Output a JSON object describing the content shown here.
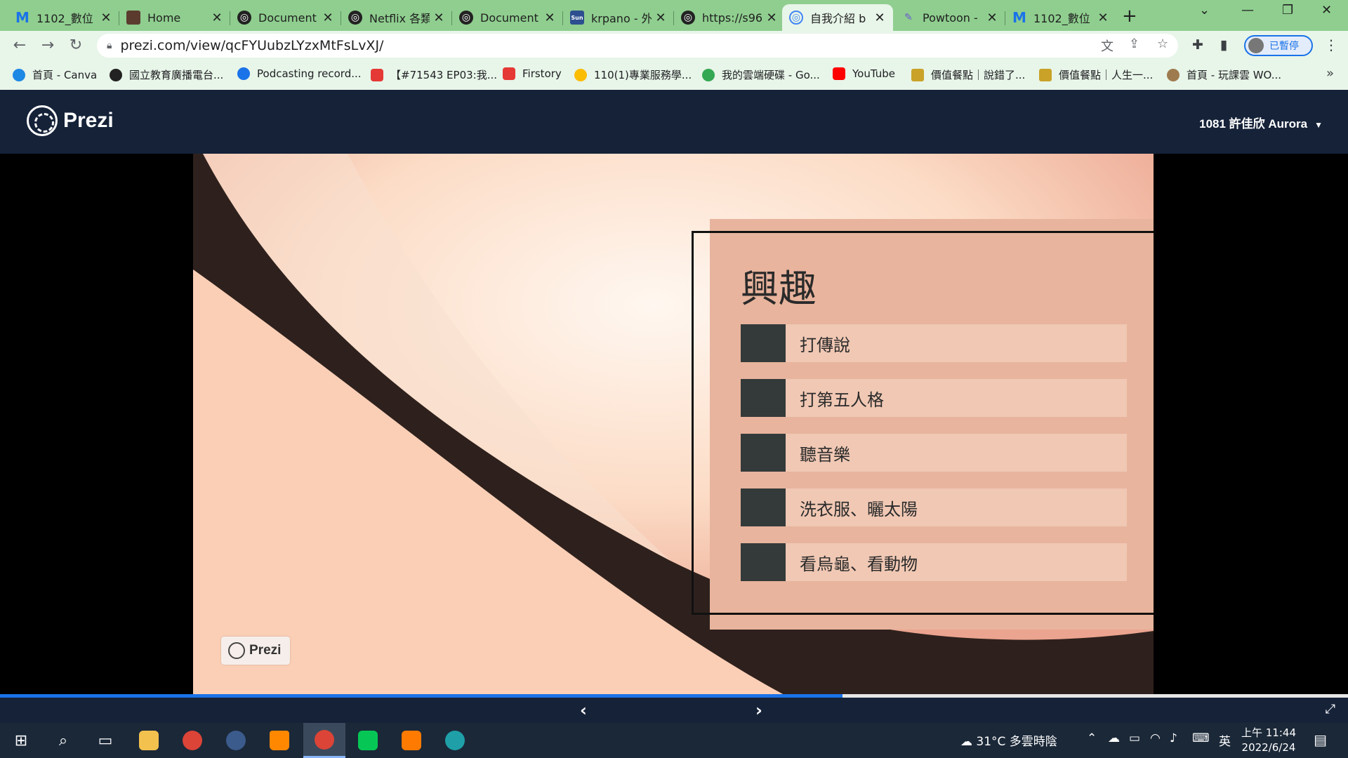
{
  "browser": {
    "tabs": [
      {
        "title": "1102_數位",
        "icon": "m-logo-icon"
      },
      {
        "title": "Home",
        "icon": "home-favicon-icon"
      },
      {
        "title": "Document",
        "icon": "globe-icon"
      },
      {
        "title": "Netflix 各類",
        "icon": "globe-icon"
      },
      {
        "title": "Document",
        "icon": "globe-icon"
      },
      {
        "title": "krpano - 外",
        "icon": "krpano-icon"
      },
      {
        "title": "https://s96",
        "icon": "globe-icon"
      },
      {
        "title": "自我介紹 b",
        "icon": "prezi-favicon-icon",
        "active": true
      },
      {
        "title": "Powtoon -",
        "icon": "powtoon-icon"
      },
      {
        "title": "1102_數位",
        "icon": "m-logo-icon"
      }
    ],
    "address": "prezi.com/view/qcFYUubzLYzxMtFsLvXJ/",
    "profile_label": "已暫停",
    "bookmarks": [
      {
        "label": "首頁 - Canva",
        "color": "#1e88e5"
      },
      {
        "label": "國立教育廣播電台...",
        "color": "#222222"
      },
      {
        "label": "Podcasting record...",
        "color": "#1a73e8"
      },
      {
        "label": "【#71543 EP03:我...",
        "color": "#e53935"
      },
      {
        "label": "Firstory",
        "color": "#e53935"
      },
      {
        "label": "110(1)專業服務學...",
        "color": "#fbbc04"
      },
      {
        "label": "我的雲端硬碟 - Go...",
        "color": "#34a853"
      },
      {
        "label": "YouTube",
        "color": "#ff0000"
      },
      {
        "label": "價值餐點｜說錯了...",
        "color": "#c9a227"
      },
      {
        "label": "價值餐點｜人生一...",
        "color": "#c9a227"
      },
      {
        "label": "首頁 - 玩課雲 WO...",
        "color": "#9e7b4f"
      }
    ]
  },
  "prezi": {
    "brand": "Prezi",
    "user": "1081 許佳欣 Aurora"
  },
  "slide": {
    "title": "興趣",
    "items": [
      "打傳說",
      "打第五人格",
      "聽音樂",
      "洗衣服、曬太陽",
      "看烏龜、看動物"
    ],
    "watermark": "Prezi"
  },
  "player": {
    "progress_fraction": 0.625
  },
  "taskbar": {
    "weather": "31°C 多雲時陰",
    "ime": "英",
    "time": "上午 11:44",
    "date": "2022/6/24"
  },
  "colors": {
    "tabstrip": "#8fce8f",
    "prezi_navy": "#152238",
    "slide_peach": "#fbd6c0",
    "frame_fill": "#e8b49d",
    "item_fill": "#f0c8b4",
    "swatch": "#343a3a",
    "progress": "#1a73e8"
  }
}
